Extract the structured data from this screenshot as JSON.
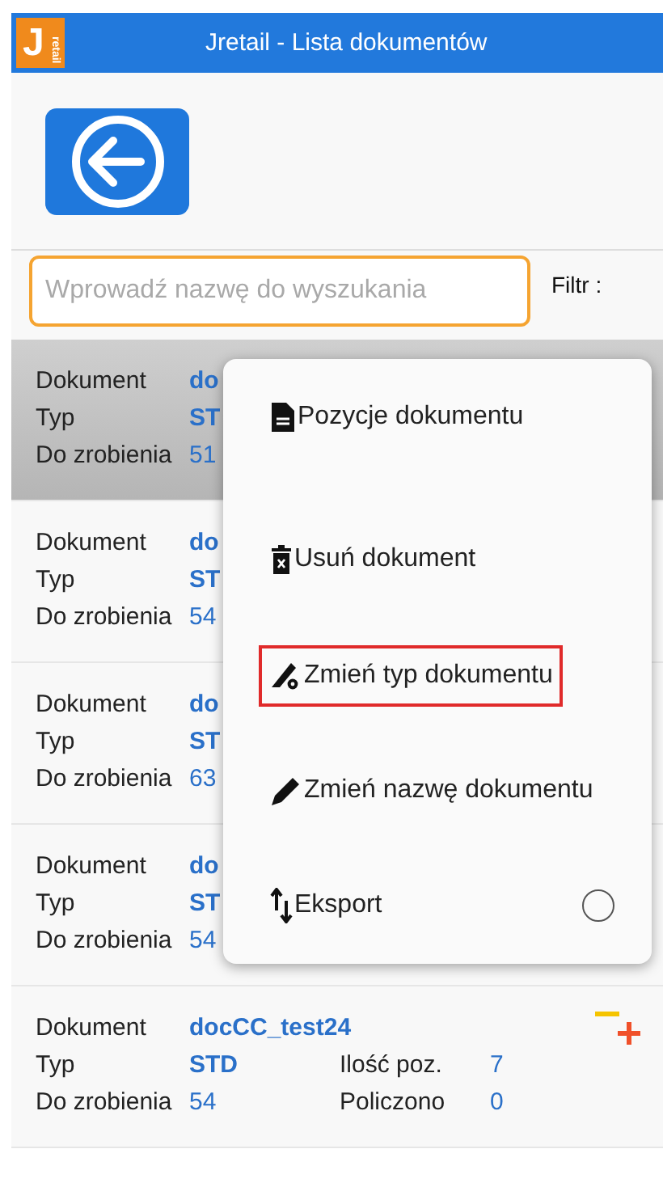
{
  "window": {
    "title": "Jretail - Lista dokumentów",
    "logo": {
      "letter": "J",
      "sub": "retail"
    }
  },
  "search": {
    "placeholder": "Wprowadź nazwę do wyszukania",
    "filter_label": "Filtr :"
  },
  "documents": [
    {
      "selected": true,
      "doc_label": "Dokument",
      "doc": "do",
      "type_label": "Typ",
      "type": "ST",
      "todo_label": "Do zrobienia",
      "todo": "51"
    },
    {
      "selected": false,
      "doc_label": "Dokument",
      "doc": "do",
      "type_label": "Typ",
      "type": "ST",
      "todo_label": "Do zrobienia",
      "todo": "54"
    },
    {
      "selected": false,
      "doc_label": "Dokument",
      "doc": "do",
      "type_label": "Typ",
      "type": "ST",
      "todo_label": "Do zrobienia",
      "todo": "63"
    },
    {
      "selected": false,
      "doc_label": "Dokument",
      "doc": "do",
      "type_label": "Typ",
      "type": "ST",
      "todo_label": "Do zrobienia",
      "todo": "54"
    },
    {
      "selected": false,
      "doc_label": "Dokument",
      "doc": "docCC_test24",
      "type_label": "Typ",
      "type": "STD",
      "todo_label": "Do zrobienia",
      "todo": "54",
      "count_label": "Ilość poz.",
      "count": "7",
      "counted_label": "Policzono",
      "counted": "0"
    }
  ],
  "context_menu": {
    "items": [
      {
        "kind": "doc",
        "label": "Pozycje dokumentu",
        "outlined": false
      },
      {
        "kind": "delete",
        "label": "Usuń dokument",
        "outlined": false
      },
      {
        "kind": "type",
        "label": "Zmień typ dokumentu",
        "outlined": true
      },
      {
        "kind": "rename",
        "label": "Zmień nazwę dokumentu",
        "outlined": false
      },
      {
        "kind": "export",
        "label": "Eksport",
        "outlined": false,
        "checked": false
      }
    ]
  }
}
